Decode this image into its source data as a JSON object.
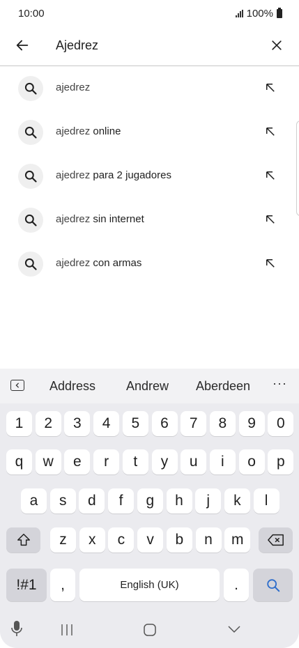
{
  "status": {
    "time": "10:00",
    "battery": "100%"
  },
  "search": {
    "query": "Ajedrez",
    "back_icon": "arrow-left-icon",
    "clear_icon": "close-icon"
  },
  "suggestions": [
    {
      "prefix": "ajedrez",
      "rest": ""
    },
    {
      "prefix": "ajedrez",
      "rest": " online"
    },
    {
      "prefix": "ajedrez",
      "rest": " para 2 jugadores"
    },
    {
      "prefix": "ajedrez",
      "rest": " sin internet"
    },
    {
      "prefix": "ajedrez",
      "rest": " con armas"
    }
  ],
  "keyboard": {
    "strip": {
      "words": [
        "Address",
        "Andrew",
        "Aberdeen"
      ],
      "more": "···"
    },
    "numbers": [
      "1",
      "2",
      "3",
      "4",
      "5",
      "6",
      "7",
      "8",
      "9",
      "0"
    ],
    "row1": [
      "q",
      "w",
      "e",
      "r",
      "t",
      "y",
      "u",
      "i",
      "o",
      "p"
    ],
    "row2": [
      "a",
      "s",
      "d",
      "f",
      "g",
      "h",
      "j",
      "k",
      "l"
    ],
    "row3": [
      "z",
      "x",
      "c",
      "v",
      "b",
      "n",
      "m"
    ],
    "symbols_label": "!#1",
    "comma_label": ",",
    "space_label": "English (UK)",
    "period_label": ".",
    "accent_color": "#2f6ecb"
  }
}
